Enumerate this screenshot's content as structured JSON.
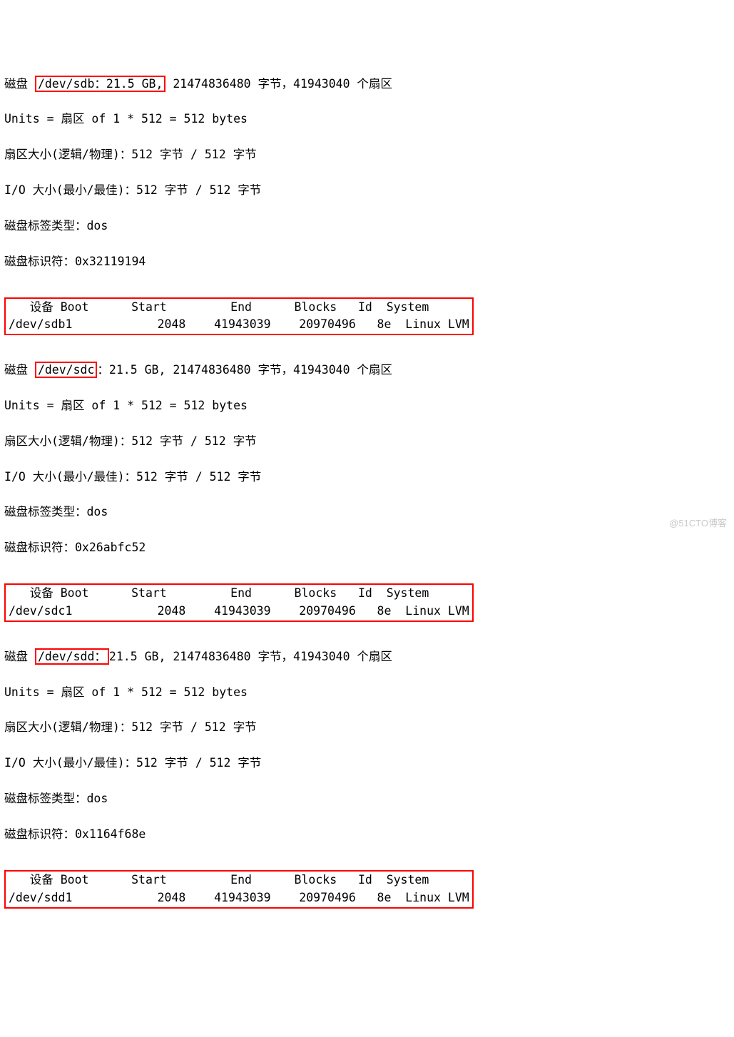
{
  "disks": [
    {
      "prefix": "磁盘 ",
      "hl": "/dev/sdb：21.5 GB,",
      "rest": " 21474836480 字节，41943040 个扇区",
      "units": "Units = 扇区 of 1 * 512 = 512 bytes",
      "sector": "扇区大小(逻辑/物理)：512 字节 / 512 字节",
      "io": "I/O 大小(最小/最佳)：512 字节 / 512 字节",
      "label": "磁盘标签类型：dos",
      "id": "磁盘标识符：0x32119194",
      "header": "   设备 Boot      Start         End      Blocks   Id  System",
      "row": "/dev/sdb1            2048    41943039    20970496   8e  Linux LVM"
    },
    {
      "prefix": "磁盘 ",
      "hl": "/dev/sdc",
      "rest": "：21.5 GB, 21474836480 字节，41943040 个扇区",
      "units": "Units = 扇区 of 1 * 512 = 512 bytes",
      "sector": "扇区大小(逻辑/物理)：512 字节 / 512 字节",
      "io": "I/O 大小(最小/最佳)：512 字节 / 512 字节",
      "label": "磁盘标签类型：dos",
      "id": "磁盘标识符：0x26abfc52",
      "header": "   设备 Boot      Start         End      Blocks   Id  System",
      "row": "/dev/sdc1            2048    41943039    20970496   8e  Linux LVM"
    },
    {
      "prefix": "磁盘 ",
      "hl": "/dev/sdd：",
      "rest": "21.5 GB, 21474836480 字节，41943040 个扇区",
      "units": "Units = 扇区 of 1 * 512 = 512 bytes",
      "sector": "扇区大小(逻辑/物理)：512 字节 / 512 字节",
      "io": "I/O 大小(最小/最佳)：512 字节 / 512 字节",
      "label": "磁盘标签类型：dos",
      "id": "磁盘标识符：0x1164f68e",
      "header": "   设备 Boot      Start         End      Blocks   Id  System",
      "row": "/dev/sdd1            2048    41943039    20970496   8e  Linux LVM"
    }
  ],
  "watermark": "@51CTO博客"
}
